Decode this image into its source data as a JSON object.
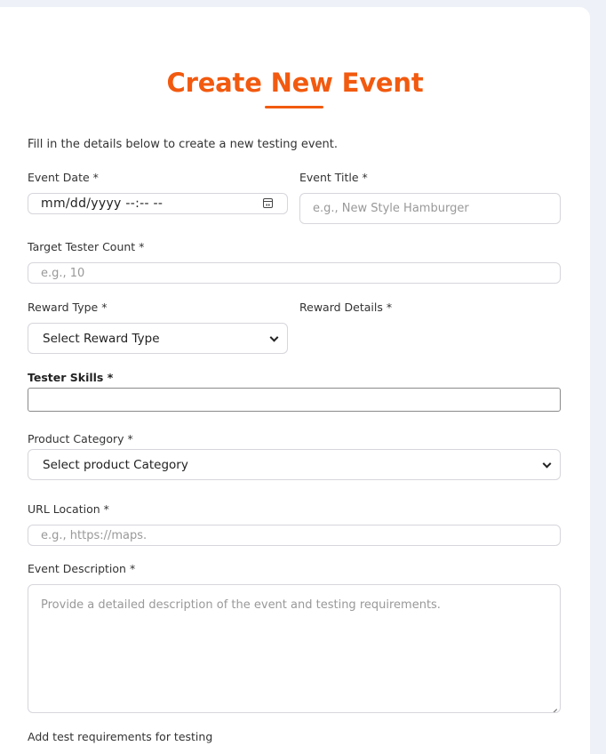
{
  "form": {
    "title": "Create New Event",
    "subtitle": "Fill in the details below to create a new testing event.",
    "event_date": {
      "label": "Event Date *",
      "value": "mm/dd/yyyy --:-- --"
    },
    "event_title": {
      "label": "Event Title *",
      "placeholder": "e.g., New Style Hamburger"
    },
    "target_tester_count": {
      "label": "Target Tester Count *",
      "placeholder": "e.g., 10"
    },
    "reward_type": {
      "label": "Reward Type *",
      "selected": "Select Reward Type"
    },
    "reward_details": {
      "label": "Reward Details *"
    },
    "tester_skills": {
      "label": "Tester Skills *",
      "value": ""
    },
    "product_category": {
      "label": "Product Category *",
      "selected": "Select product Category"
    },
    "url_location": {
      "label": "URL Location *",
      "placeholder": "e.g., https://maps."
    },
    "event_description": {
      "label": "Event Description *",
      "placeholder": "Provide a detailed description of the event and testing requirements."
    },
    "test_requirements": {
      "label": "Add test requirements for testing"
    }
  },
  "icons": {
    "date": "calendar-icon",
    "select": "chevron-down-icon",
    "textarea": "resize-handle-icon"
  },
  "colors": {
    "accent": "#f25a0f",
    "background": "#eef1f8",
    "card": "#ffffff"
  }
}
